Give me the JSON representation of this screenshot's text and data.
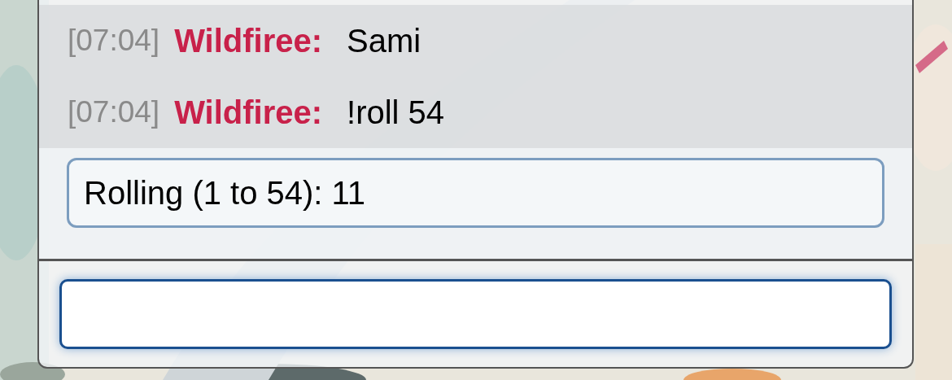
{
  "messages": [
    {
      "time": "[07:04]",
      "author": "Wildfiree:",
      "text": "Sami"
    },
    {
      "time": "[07:04]",
      "author": "Wildfiree:",
      "text": "!roll 54"
    }
  ],
  "roll_result": "Rolling (1 to 54): 11"
}
